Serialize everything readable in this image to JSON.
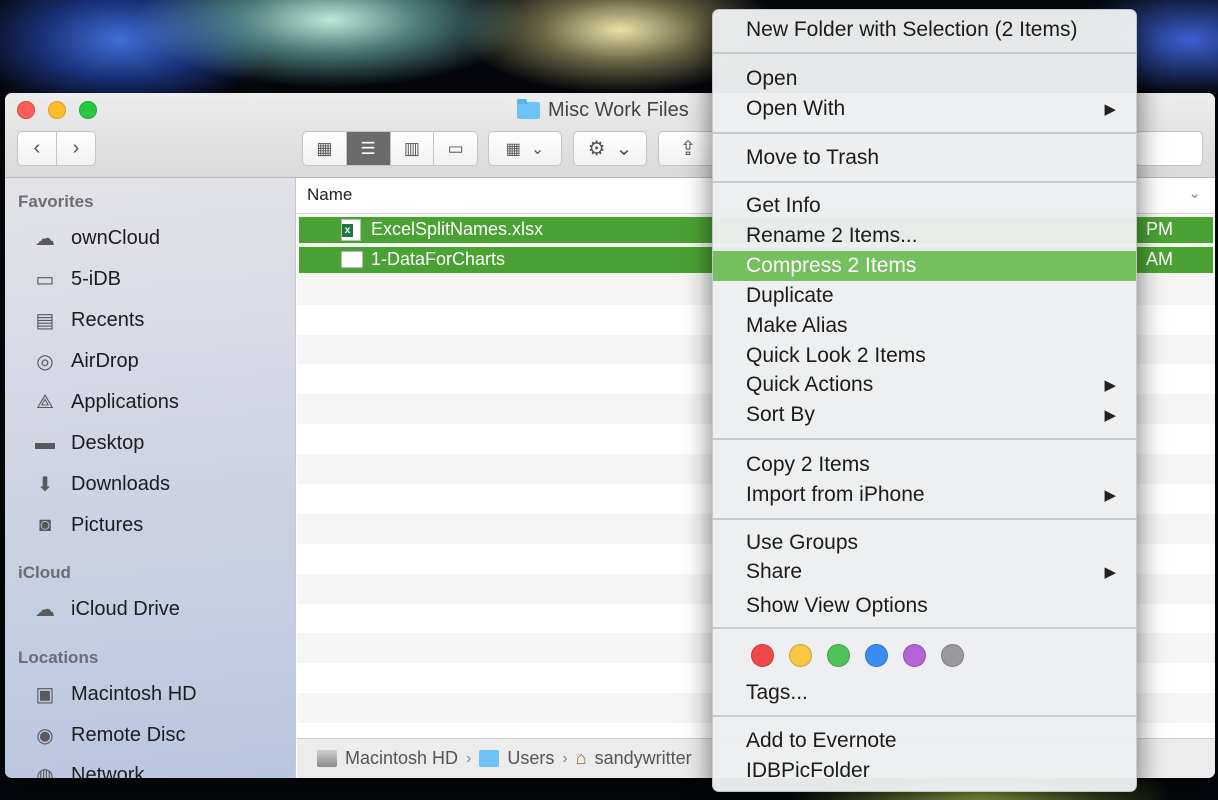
{
  "window": {
    "title": "Misc Work Files",
    "nav_back": "‹",
    "nav_forward": "›",
    "view_modes": [
      "▦",
      "☰",
      "▥",
      "▭"
    ],
    "group_icon": "▦",
    "action_icon": "⚙",
    "share_icon": "⇪"
  },
  "sidebar": {
    "favorites_heading": "Favorites",
    "favorites": [
      {
        "label": "ownCloud",
        "icon": "cloud-icon",
        "glyph": "☁"
      },
      {
        "label": "5-iDB",
        "icon": "folder-icon",
        "glyph": "▭"
      },
      {
        "label": "Recents",
        "icon": "recents-icon",
        "glyph": "▤"
      },
      {
        "label": "AirDrop",
        "icon": "airdrop-icon",
        "glyph": "◎"
      },
      {
        "label": "Applications",
        "icon": "applications-icon",
        "glyph": "⟁"
      },
      {
        "label": "Desktop",
        "icon": "desktop-icon",
        "glyph": "▬"
      },
      {
        "label": "Downloads",
        "icon": "downloads-icon",
        "glyph": "⬇"
      },
      {
        "label": "Pictures",
        "icon": "camera-icon",
        "glyph": "◙"
      }
    ],
    "icloud_heading": "iCloud",
    "icloud": [
      {
        "label": "iCloud Drive",
        "icon": "icloud-icon",
        "glyph": "☁"
      }
    ],
    "locations_heading": "Locations",
    "locations": [
      {
        "label": "Macintosh HD",
        "icon": "harddisk-icon",
        "glyph": "▣"
      },
      {
        "label": "Remote Disc",
        "icon": "disc-icon",
        "glyph": "◉"
      },
      {
        "label": "Network",
        "icon": "network-icon",
        "glyph": "◍"
      }
    ]
  },
  "filelist": {
    "column_name": "Name",
    "column_chevron": "⌄",
    "rows": [
      {
        "name": "ExcelSplitNames.xlsx",
        "time": "PM",
        "icon": "excel-file-icon",
        "selected": true
      },
      {
        "name": "1-DataForCharts",
        "time": "AM",
        "icon": "document-icon",
        "selected": true
      }
    ]
  },
  "pathbar": {
    "items": [
      "Macintosh HD",
      "Users",
      "sandywritter"
    ],
    "separator": "›"
  },
  "context_menu": {
    "items": [
      {
        "label": "New Folder with Selection (2 Items)",
        "submenu": false
      },
      {
        "label": "Open",
        "submenu": false
      },
      {
        "label": "Open With",
        "submenu": true
      },
      {
        "label": "Move to Trash",
        "submenu": false
      },
      {
        "label": "Get Info",
        "submenu": false
      },
      {
        "label": "Rename 2 Items...",
        "submenu": false
      },
      {
        "label": "Compress 2 Items",
        "submenu": false,
        "highlighted": true
      },
      {
        "label": "Duplicate",
        "submenu": false
      },
      {
        "label": "Make Alias",
        "submenu": false
      },
      {
        "label": "Quick Look 2 Items",
        "submenu": false
      },
      {
        "label": "Quick Actions",
        "submenu": true
      },
      {
        "label": "Sort By",
        "submenu": true
      },
      {
        "label": "Copy 2 Items",
        "submenu": false
      },
      {
        "label": "Import from iPhone",
        "submenu": true
      },
      {
        "label": "Use Groups",
        "submenu": false
      },
      {
        "label": "Share",
        "submenu": true
      },
      {
        "label": "Show View Options",
        "submenu": false
      },
      {
        "label": "Tags...",
        "submenu": false
      },
      {
        "label": "Add to Evernote",
        "submenu": false
      },
      {
        "label": "IDBPicFolder",
        "submenu": false
      }
    ],
    "submenu_arrow": "▶",
    "tag_colors": [
      "#f0484a",
      "#f7c844",
      "#4ec25a",
      "#3a8df0",
      "#b464d6",
      "#9a9a9c"
    ]
  }
}
